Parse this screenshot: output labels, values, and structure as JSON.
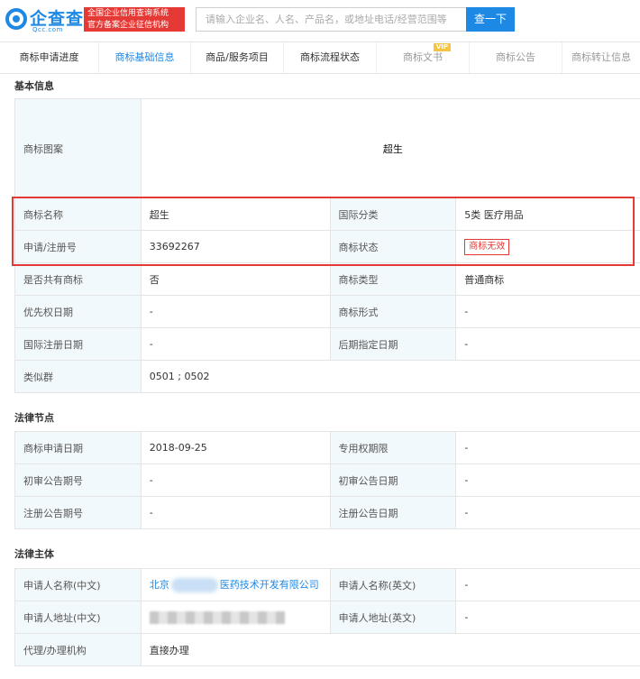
{
  "header": {
    "logo_text": "企查查",
    "logo_sub": "Qcc.com",
    "badge_line1": "全国企业信用查询系统",
    "badge_line2": "官方备案企业征信机构",
    "search_placeholder": "请输入企业名、人名、产品名，或地址电话/经营范围等",
    "search_button": "查一下"
  },
  "tabs": [
    {
      "label": "商标申请进度",
      "state": "normal"
    },
    {
      "label": "商标基础信息",
      "state": "active"
    },
    {
      "label": "商品/服务项目",
      "state": "normal"
    },
    {
      "label": "商标流程状态",
      "state": "normal"
    },
    {
      "label": "商标文书",
      "state": "disabled",
      "badge": "VIP"
    },
    {
      "label": "商标公告",
      "state": "disabled"
    },
    {
      "label": "商标转让信息",
      "state": "disabled"
    }
  ],
  "basic": {
    "title": "基本信息",
    "image_label": "商标图案",
    "image_text": "超生",
    "name_label": "商标名称",
    "name_value": "超生",
    "intl_class_label": "国际分类",
    "intl_class_value": "5类 医疗用品",
    "reg_no_label": "申请/注册号",
    "reg_no_value": "33692267",
    "status_label": "商标状态",
    "status_value": "商标无效",
    "shared_label": "是否共有商标",
    "shared_value": "否",
    "type_label": "商标类型",
    "type_value": "普通商标",
    "priority_label": "优先权日期",
    "priority_value": "-",
    "form_label": "商标形式",
    "form_value": "-",
    "intl_reg_label": "国际注册日期",
    "intl_reg_value": "-",
    "later_label": "后期指定日期",
    "later_value": "-",
    "group_label": "类似群",
    "group_value": "0501 ; 0502"
  },
  "legal_nodes": {
    "title": "法律节点",
    "apply_date_label": "商标申请日期",
    "apply_date_value": "2018-09-25",
    "exclusive_label": "专用权期限",
    "exclusive_value": "-",
    "prelim_no_label": "初审公告期号",
    "prelim_no_value": "-",
    "prelim_date_label": "初审公告日期",
    "prelim_date_value": "-",
    "reg_no_label": "注册公告期号",
    "reg_no_value": "-",
    "reg_date_label": "注册公告日期",
    "reg_date_value": "-"
  },
  "legal_subject": {
    "title": "法律主体",
    "applicant_cn_label": "申请人名称(中文)",
    "applicant_cn_prefix": "北京",
    "applicant_cn_suffix": "医药技术开发有限公司",
    "applicant_en_label": "申请人名称(英文)",
    "applicant_en_value": "-",
    "address_cn_label": "申请人地址(中文)",
    "address_en_label": "申请人地址(英文)",
    "address_en_value": "-",
    "agent_label": "代理/办理机构",
    "agent_value": "直接办理"
  },
  "colors": {
    "accent": "#1e88e5",
    "danger": "#e53935",
    "label_bg": "#f2f9fc"
  }
}
